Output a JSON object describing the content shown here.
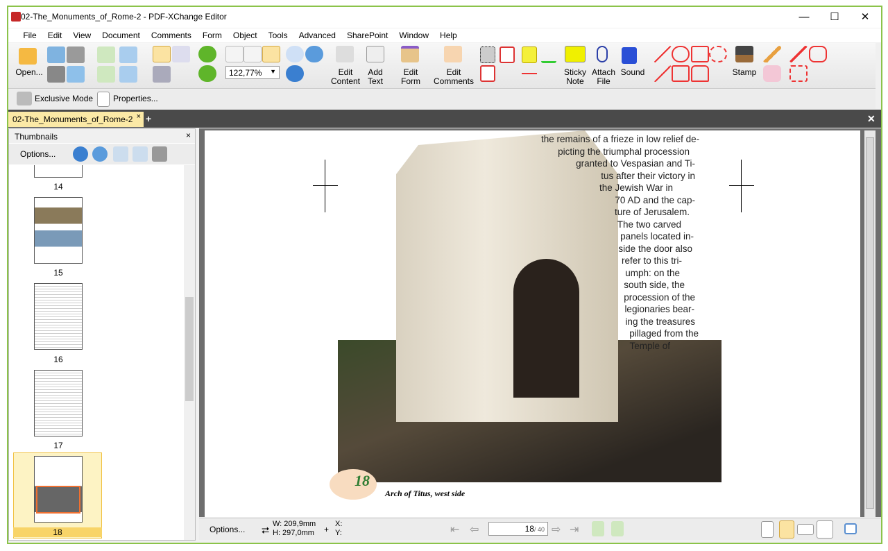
{
  "window": {
    "title": "02-The_Monuments_of_Rome-2 - PDF-XChange Editor",
    "minimize": "—",
    "maximize": "☐",
    "close": "✕"
  },
  "menu": [
    "File",
    "Edit",
    "View",
    "Document",
    "Comments",
    "Form",
    "Object",
    "Tools",
    "Advanced",
    "SharePoint",
    "Window",
    "Help"
  ],
  "toolbar": {
    "open": "Open...",
    "zoom": "122,77%",
    "edit_content": [
      "Edit",
      "Content"
    ],
    "add_text": [
      "Add",
      "Text"
    ],
    "edit_form": [
      "Edit",
      "Form"
    ],
    "edit_comments": [
      "Edit",
      "Comments"
    ],
    "sticky_note": [
      "Sticky",
      "Note"
    ],
    "attach_file": [
      "Attach",
      "File"
    ],
    "sound": "Sound",
    "stamp": "Stamp"
  },
  "toolbar2": {
    "exclusive_mode": "Exclusive Mode",
    "properties": "Properties..."
  },
  "tabs": [
    {
      "label": "02-The_Monuments_of_Rome-2",
      "close": "×",
      "active": true
    }
  ],
  "thumbnails": {
    "title": "Thumbnails",
    "options": "Options...",
    "pages": [
      "14",
      "15",
      "16",
      "17",
      "18"
    ],
    "selected": "18"
  },
  "page": {
    "text_lines": [
      "the remains of a frieze in low relief de-",
      "picting the triumphal procession",
      "granted to Vespasian and Ti-",
      "tus after their victory in",
      "the Jewish War in",
      "70 AD and the cap-",
      "ture of Jerusalem.",
      "The two carved",
      "panels located in-",
      "side the door also",
      "refer to this tri-",
      "umph: on the",
      "south side, the",
      "procession of the",
      "legionaries bear-",
      "ing the treasures",
      "pillaged from the",
      "Temple of"
    ],
    "page_number": "18",
    "caption": "Arch of Titus, west side"
  },
  "status": {
    "options": "Options...",
    "width": "W: 209,9mm",
    "height": "H: 297,0mm",
    "x": "X:",
    "y": "Y:",
    "current_page": "18",
    "total_pages": "/ 40"
  },
  "colors": {
    "accent": "#8bc34a",
    "tab_active": "#fbe9a6",
    "page_number": "#2e7d32"
  }
}
